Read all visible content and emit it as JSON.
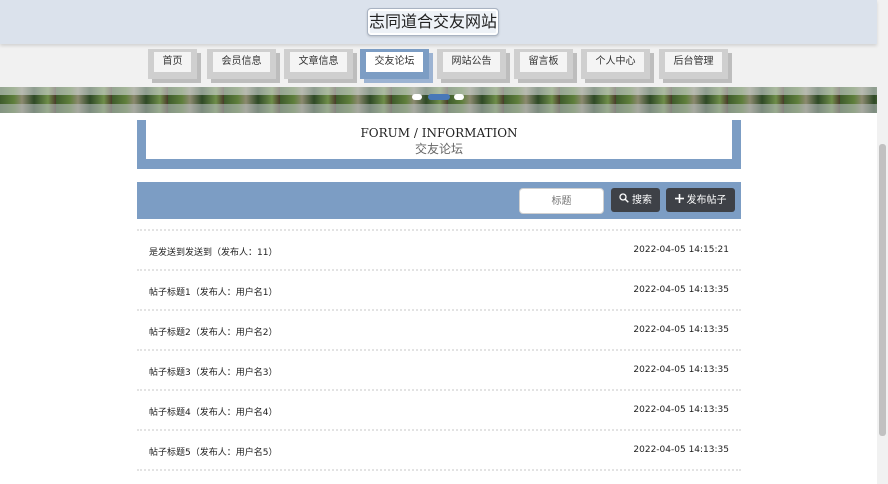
{
  "site": {
    "title": "志同道合交友网站"
  },
  "nav": {
    "items": [
      {
        "label": "首页",
        "active": false
      },
      {
        "label": "会员信息",
        "active": false
      },
      {
        "label": "文章信息",
        "active": false
      },
      {
        "label": "交友论坛",
        "active": true
      },
      {
        "label": "网站公告",
        "active": false
      },
      {
        "label": "留言板",
        "active": false
      },
      {
        "label": "个人中心",
        "active": false
      },
      {
        "label": "后台管理",
        "active": false
      }
    ]
  },
  "banner": {
    "slide_count": 3,
    "active_slide": 2
  },
  "forum": {
    "heading_en": "FORUM / INFORMATION",
    "heading_cn": "交友论坛"
  },
  "toolbar": {
    "search_placeholder": "标题",
    "search_label": "搜索",
    "search_icon": "search-icon",
    "post_label": "发布帖子",
    "post_icon": "plus-icon"
  },
  "posts": [
    {
      "title": "是发送到发送到（发布人：11）",
      "time": "2022-04-05 14:15:21"
    },
    {
      "title": "帖子标题1（发布人：用户名1）",
      "time": "2022-04-05 14:13:35"
    },
    {
      "title": "帖子标题2（发布人：用户名2）",
      "time": "2022-04-05 14:13:35"
    },
    {
      "title": "帖子标题3（发布人：用户名3）",
      "time": "2022-04-05 14:13:35"
    },
    {
      "title": "帖子标题4（发布人：用户名4）",
      "time": "2022-04-05 14:13:35"
    },
    {
      "title": "帖子标题5（发布人：用户名5）",
      "time": "2022-04-05 14:13:35"
    }
  ],
  "colors": {
    "accent": "#7c9dc4",
    "topbar": "#dbe2ec",
    "button_dark": "#3e4147"
  }
}
